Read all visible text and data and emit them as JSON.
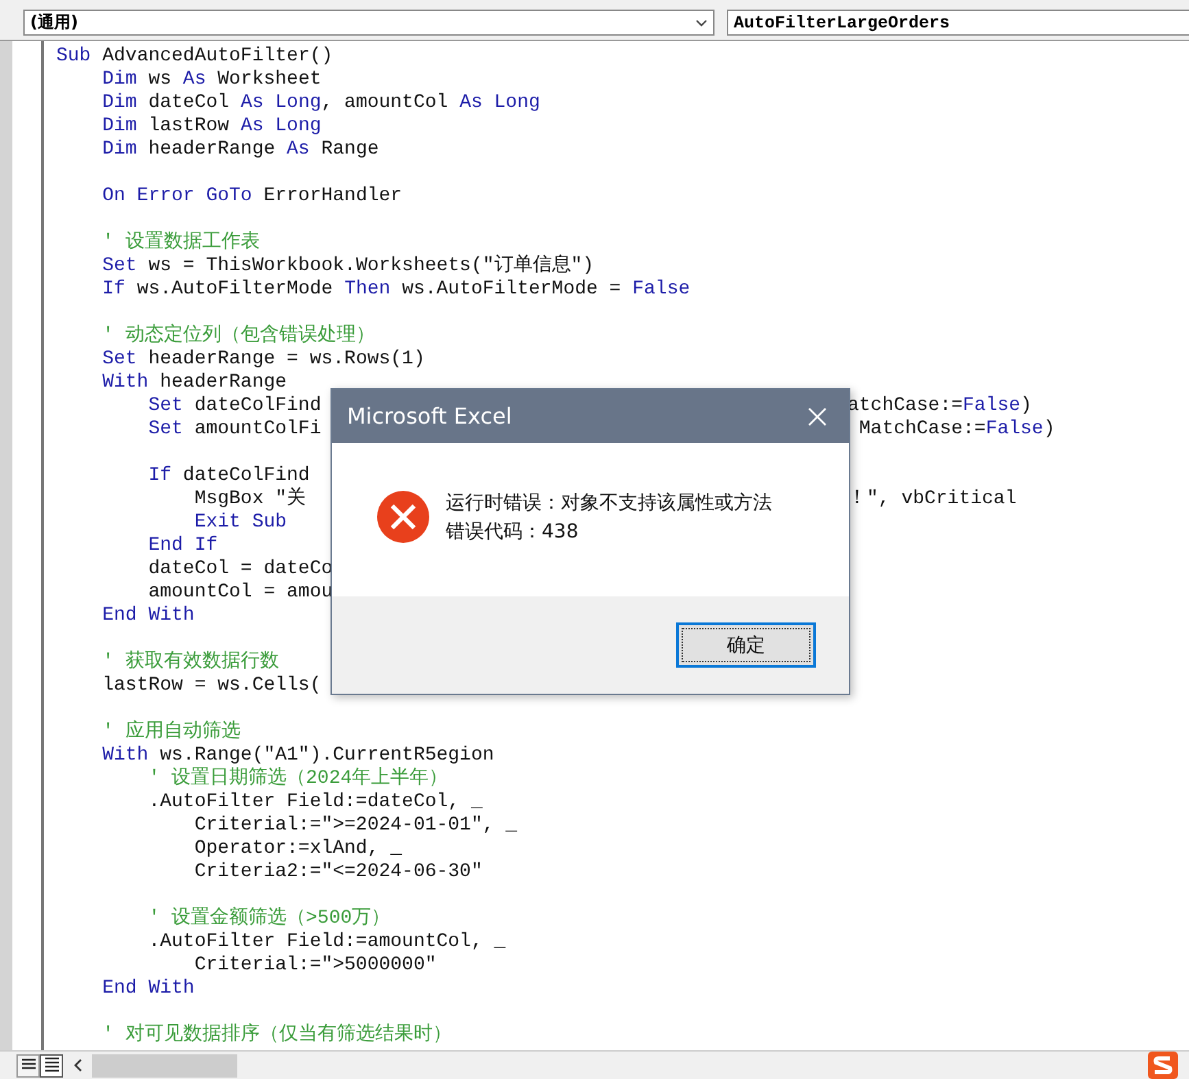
{
  "object_combo": {
    "value": "(通用)"
  },
  "procedure_combo": {
    "value": "AutoFilterLargeOrders"
  },
  "code_lines": [
    {
      "tokens": [
        {
          "kind": "keyword",
          "text": "Sub"
        },
        {
          "kind": "plain",
          "text": " AdvancedAutoFilter()"
        }
      ]
    },
    {
      "tokens": [
        {
          "kind": "keyword",
          "text": "    Dim"
        },
        {
          "kind": "plain",
          "text": " ws "
        },
        {
          "kind": "keyword",
          "text": "As"
        },
        {
          "kind": "plain",
          "text": " Worksheet"
        }
      ]
    },
    {
      "tokens": [
        {
          "kind": "keyword",
          "text": "    Dim"
        },
        {
          "kind": "plain",
          "text": " dateCol "
        },
        {
          "kind": "keyword",
          "text": "As Long"
        },
        {
          "kind": "plain",
          "text": ", amountCol "
        },
        {
          "kind": "keyword",
          "text": "As Long"
        }
      ]
    },
    {
      "tokens": [
        {
          "kind": "keyword",
          "text": "    Dim"
        },
        {
          "kind": "plain",
          "text": " lastRow "
        },
        {
          "kind": "keyword",
          "text": "As Long"
        }
      ]
    },
    {
      "tokens": [
        {
          "kind": "keyword",
          "text": "    Dim"
        },
        {
          "kind": "plain",
          "text": " headerRange "
        },
        {
          "kind": "keyword",
          "text": "As"
        },
        {
          "kind": "plain",
          "text": " Range"
        }
      ]
    },
    {
      "kind": "blank"
    },
    {
      "tokens": [
        {
          "kind": "keyword",
          "text": "    On Error GoTo"
        },
        {
          "kind": "plain",
          "text": " ErrorHandler"
        }
      ]
    },
    {
      "kind": "blank"
    },
    {
      "tokens": [
        {
          "kind": "comment",
          "text": "    ' 设置数据工作表"
        }
      ]
    },
    {
      "tokens": [
        {
          "kind": "keyword",
          "text": "    Set"
        },
        {
          "kind": "plain",
          "text": " ws = ThisWorkbook.Worksheets(\"订单信息\")"
        }
      ]
    },
    {
      "tokens": [
        {
          "kind": "keyword",
          "text": "    If"
        },
        {
          "kind": "plain",
          "text": " ws.AutoFilterMode "
        },
        {
          "kind": "keyword",
          "text": "Then"
        },
        {
          "kind": "plain",
          "text": " ws.AutoFilterMode = "
        },
        {
          "kind": "keyword",
          "text": "False"
        }
      ]
    },
    {
      "kind": "blank"
    },
    {
      "tokens": [
        {
          "kind": "comment",
          "text": "    ' 动态定位列（包含错误处理）"
        }
      ]
    },
    {
      "tokens": [
        {
          "kind": "keyword",
          "text": "    Set"
        },
        {
          "kind": "plain",
          "text": " headerRange = ws.Rows(1)"
        }
      ]
    },
    {
      "tokens": [
        {
          "kind": "keyword",
          "text": "    With"
        },
        {
          "kind": "plain",
          "text": " headerRange"
        }
      ]
    },
    {
      "tokens": [
        {
          "kind": "keyword",
          "text": "        Set"
        },
        {
          "kind": "plain",
          "text": " dateColFind"
        }
      ],
      "right": [
        {
          "kind": "plain",
          "text": "atchCase:="
        },
        {
          "kind": "keyword",
          "text": "False"
        },
        {
          "kind": "plain",
          "text": ")"
        }
      ]
    },
    {
      "tokens": [
        {
          "kind": "keyword",
          "text": "        Set"
        },
        {
          "kind": "plain",
          "text": " amountColFi"
        }
      ],
      "right": [
        {
          "kind": "plain",
          "text": " MatchCase:="
        },
        {
          "kind": "keyword",
          "text": "False"
        },
        {
          "kind": "plain",
          "text": ")"
        }
      ]
    },
    {
      "kind": "blank"
    },
    {
      "tokens": [
        {
          "kind": "keyword",
          "text": "        If"
        },
        {
          "kind": "plain",
          "text": " dateColFind"
        }
      ]
    },
    {
      "tokens": [
        {
          "kind": "plain",
          "text": "            MsgBox \"关"
        }
      ],
      "right": [
        {
          "kind": "plain",
          "text": "！\", vbCritical"
        }
      ]
    },
    {
      "tokens": [
        {
          "kind": "keyword",
          "text": "            Exit Sub"
        }
      ]
    },
    {
      "tokens": [
        {
          "kind": "keyword",
          "text": "        End If"
        }
      ]
    },
    {
      "tokens": [
        {
          "kind": "plain",
          "text": "        dateCol = dateCo"
        }
      ]
    },
    {
      "tokens": [
        {
          "kind": "plain",
          "text": "        amountCol = amou"
        }
      ]
    },
    {
      "tokens": [
        {
          "kind": "keyword",
          "text": "    End With"
        }
      ]
    },
    {
      "kind": "blank"
    },
    {
      "tokens": [
        {
          "kind": "comment",
          "text": "    ' 获取有效数据行数"
        }
      ]
    },
    {
      "tokens": [
        {
          "kind": "plain",
          "text": "    lastRow = ws.Cells("
        }
      ]
    },
    {
      "kind": "blank"
    },
    {
      "tokens": [
        {
          "kind": "comment",
          "text": "    ' 应用自动筛选"
        }
      ]
    },
    {
      "tokens": [
        {
          "kind": "keyword",
          "text": "    With"
        },
        {
          "kind": "plain",
          "text": " ws.Range(\"A1\").CurrentR5egion"
        }
      ]
    },
    {
      "tokens": [
        {
          "kind": "comment",
          "text": "        ' 设置日期筛选（2024年上半年）"
        }
      ]
    },
    {
      "tokens": [
        {
          "kind": "plain",
          "text": "        .AutoFilter Field:=dateCol, _"
        }
      ]
    },
    {
      "tokens": [
        {
          "kind": "plain",
          "text": "            Criterial:=\">=2024-01-01\", _"
        }
      ]
    },
    {
      "tokens": [
        {
          "kind": "plain",
          "text": "            Operator:=xlAnd, _"
        }
      ]
    },
    {
      "tokens": [
        {
          "kind": "plain",
          "text": "            Criteria2:=\"<=2024-06-30\""
        }
      ]
    },
    {
      "kind": "blank"
    },
    {
      "tokens": [
        {
          "kind": "comment",
          "text": "        ' 设置金额筛选（>500万）"
        }
      ]
    },
    {
      "tokens": [
        {
          "kind": "plain",
          "text": "        .AutoFilter Field:=amountCol, _"
        }
      ]
    },
    {
      "tokens": [
        {
          "kind": "plain",
          "text": "            Criterial:=\">5000000\""
        }
      ]
    },
    {
      "tokens": [
        {
          "kind": "keyword",
          "text": "    End With"
        }
      ]
    },
    {
      "kind": "blank"
    },
    {
      "tokens": [
        {
          "kind": "comment",
          "text": "    ' 对可见数据排序（仅当有筛选结果时）"
        }
      ]
    }
  ],
  "dialog": {
    "title": "Microsoft Excel",
    "message": [
      "运行时错误：对象不支持该属性或方法",
      "错误代码：438"
    ],
    "ok_button": "确定"
  }
}
